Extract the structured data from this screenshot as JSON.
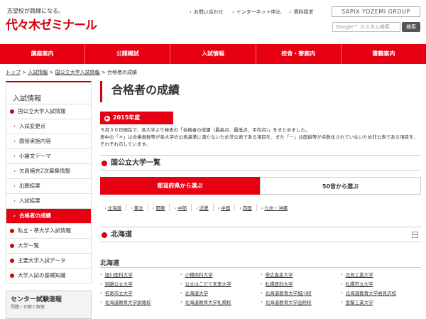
{
  "header": {
    "tagline": "志望校が路線になる。",
    "logo": "代々木ゼミナール",
    "links": [
      "お問い合わせ",
      "インターネット申込",
      "資料請求"
    ],
    "group": "SAPIX YOZEMI GROUP",
    "search_placeholder": "Google™ カスタム検索",
    "search_button": "検索"
  },
  "nav": [
    "講座案内",
    "公開模試",
    "入試情報",
    "校舎・寮案内",
    "書籍案内"
  ],
  "breadcrumb": [
    "トップ",
    "入試情報",
    "国公立大学入試情報",
    "合格者の成績"
  ],
  "sidebar": {
    "title": "入試情報",
    "items": [
      {
        "label": "国公立大学入試情報",
        "level": 0
      },
      {
        "label": "入試変更点",
        "level": 1
      },
      {
        "label": "面接実施内容",
        "level": 1
      },
      {
        "label": "小論文テーマ",
        "level": 1
      },
      {
        "label": "欠員補充2次募集情報",
        "level": 1
      },
      {
        "label": "出願結果",
        "level": 1
      },
      {
        "label": "入試結果",
        "level": 1
      },
      {
        "label": "合格者の成績",
        "level": 1,
        "active": true
      },
      {
        "label": "私立・準大学入試情報",
        "level": 0
      },
      {
        "label": "大学一覧",
        "level": 0
      },
      {
        "label": "主要大学入試データ",
        "level": 0
      },
      {
        "label": "大学入試の基礎知識",
        "level": 0
      }
    ],
    "banner_title": "センター試験速報",
    "banner_sub": "問題・正解と解答"
  },
  "main": {
    "title": "合格者の成績",
    "year": "2015年度",
    "intro": "９月３０日現在で、各大学より発表の「合格者の成績（最高点、最低点、平均点）」をまとめました。\n表中の「＊」は合格者数等が各大学の公表基準に満たないため非公表である項目を、また「－」は面接等が点数化されていないため非公表である項目を、それぞれ示しています。",
    "section1": "国公立大学一覧",
    "tabs": [
      "都道府県から選ぶ",
      "50音から選ぶ"
    ],
    "prefs": [
      "北海道",
      "東北",
      "関東",
      "中部",
      "近畿",
      "中国",
      "四国",
      "九州・沖縄"
    ],
    "section2": "北海道",
    "collapse": "－",
    "region": "北海道",
    "universities": [
      "旭川医科大学",
      "小樽商科大学",
      "帯広畜産大学",
      "北見工業大学",
      "釧路公立大学",
      "公立はこだて未来大学",
      "札幌医科大学",
      "札幌市立大学",
      "名寄市立大学",
      "北海道大学",
      "北海道教育大学旭川校",
      "北海道教育大学岩見沢校",
      "北海道教育大学釧路校",
      "北海道教育大学札幌校",
      "北海道教育大学函館校",
      "室蘭工業大学"
    ]
  }
}
